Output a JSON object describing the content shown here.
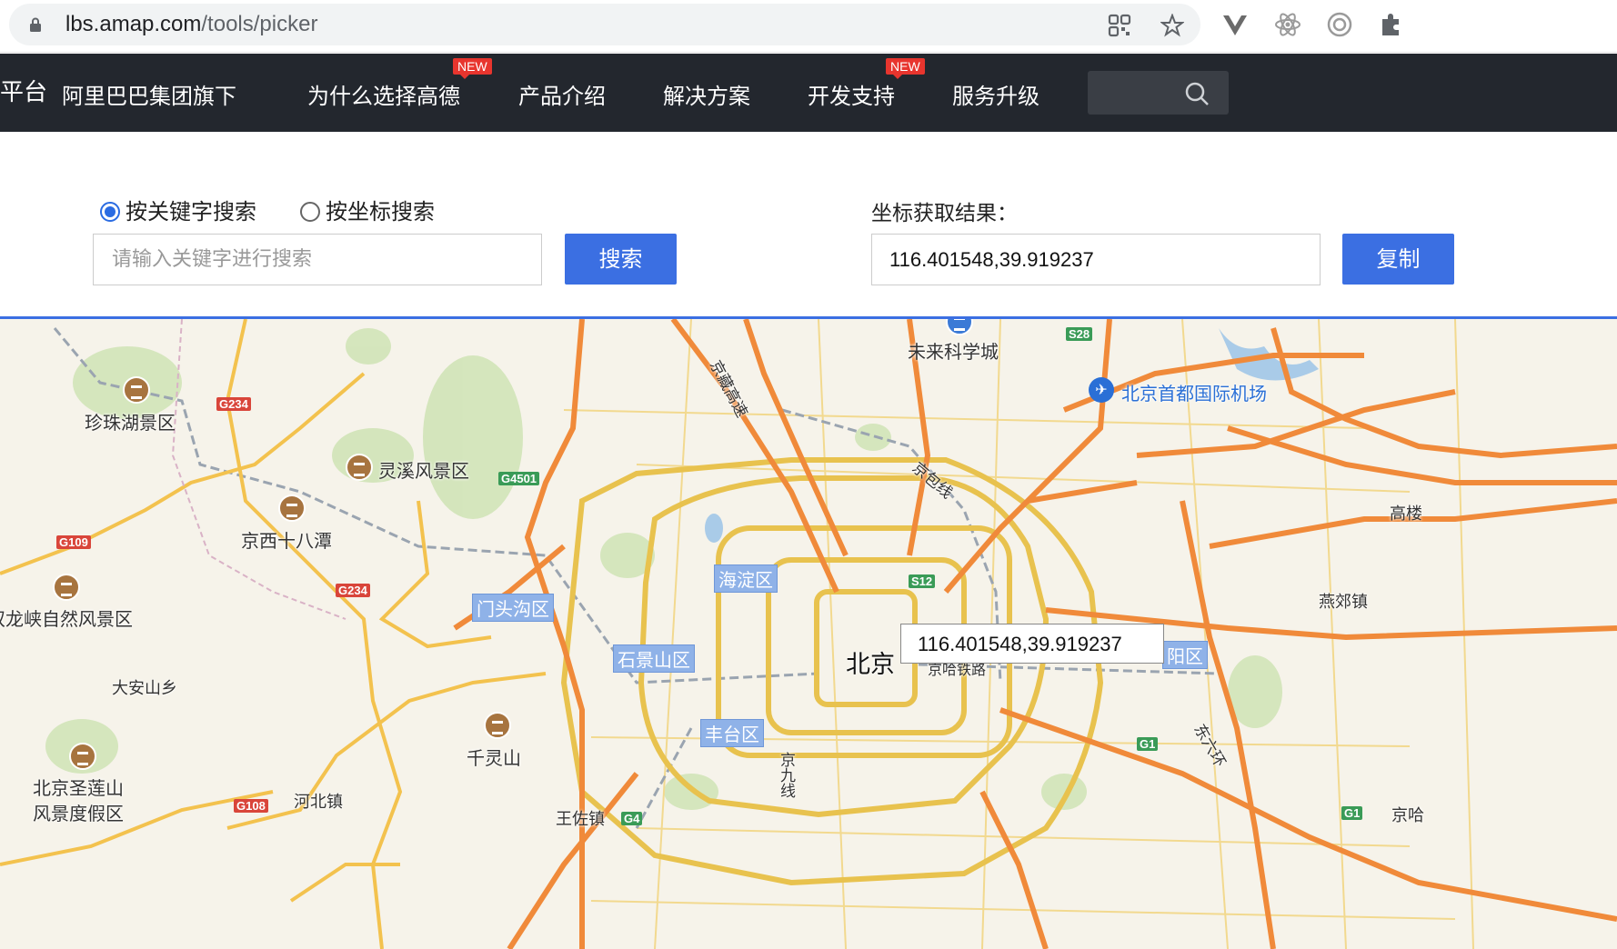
{
  "browser": {
    "url_host": "lbs.amap.com",
    "url_path": "/tools/picker"
  },
  "nav": {
    "logo_fragment": "平台",
    "items": [
      {
        "label": "阿里巴巴集团旗下",
        "badge": ""
      },
      {
        "label": "为什么选择高德",
        "badge": "NEW"
      },
      {
        "label": "产品介绍",
        "badge": ""
      },
      {
        "label": "解决方案",
        "badge": ""
      },
      {
        "label": "开发支持",
        "badge": "NEW"
      },
      {
        "label": "服务升级",
        "badge": ""
      }
    ]
  },
  "picker": {
    "radio_keyword": "按关键字搜索",
    "radio_coord": "按坐标搜索",
    "selected": "keyword",
    "keyword_placeholder": "请输入关键字进行搜索",
    "search_button": "搜索",
    "result_label": "坐标获取结果：",
    "result_value": "116.401548,39.919237",
    "copy_button": "复制"
  },
  "map": {
    "center_city": "北京",
    "tooltip": "116.401548,39.919237",
    "places": {
      "zhenzhu": "珍珠湖景区",
      "lingxi": "灵溪风景区",
      "jingxi": "京西十八潭",
      "longxia": "双龙峡自然风景区",
      "daan": "大安山乡",
      "qianling": "千灵山",
      "shenglian_1": "北京圣莲山",
      "shenglian_2": "风景度假区",
      "hebei": "河北镇",
      "wangzuo": "王佐镇",
      "weilai": "未来科学城",
      "airport": "北京首都国际机场",
      "gaolou": "高楼",
      "yanjiao": "燕郊镇",
      "jingzang": "京藏高速",
      "jingbao": "京包线",
      "jingha_rail": "京哈铁路",
      "dongliu": "东六环",
      "jingjiu": "京九线",
      "jingha": "京哈"
    },
    "districts": {
      "haidian": "海淀区",
      "mentougou": "门头沟区",
      "shijingshan": "石景山区",
      "fengtai": "丰台区",
      "chaoyang": "阳区"
    },
    "shields": [
      "G234",
      "G4501",
      "G109",
      "G234",
      "G108",
      "S28",
      "S12",
      "G1",
      "G4",
      "G1"
    ]
  }
}
